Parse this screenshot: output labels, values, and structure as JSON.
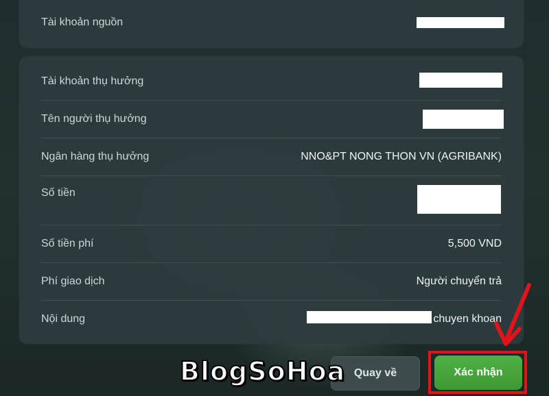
{
  "source_card": {
    "label": "Tài khoản nguồn"
  },
  "details": {
    "beneficiary_account_label": "Tài khoản thụ hưởng",
    "beneficiary_name_label": "Tên người thụ hưởng",
    "beneficiary_bank_label": "Ngân hàng thụ hưởng",
    "beneficiary_bank_value": "NNO&PT NONG THON VN (AGRIBANK)",
    "amount_label": "Số tiền",
    "fee_label": "Số tiền phí",
    "fee_value": "5,500 VND",
    "fee_payer_label": "Phí giao dịch",
    "fee_payer_value": "Người chuyển trả",
    "content_label": "Nội dung",
    "content_value_suffix": "chuyen khoan"
  },
  "buttons": {
    "back_label": "Quay về",
    "confirm_label": "Xác nhận"
  },
  "watermark": {
    "text": "BlogSoHoa"
  },
  "colors": {
    "confirm_green": "#45a63b",
    "highlight_red": "#e0151b",
    "card_bg": "#2c3c3e"
  },
  "icons": {
    "annotation_arrow": "red-arrow-icon"
  }
}
